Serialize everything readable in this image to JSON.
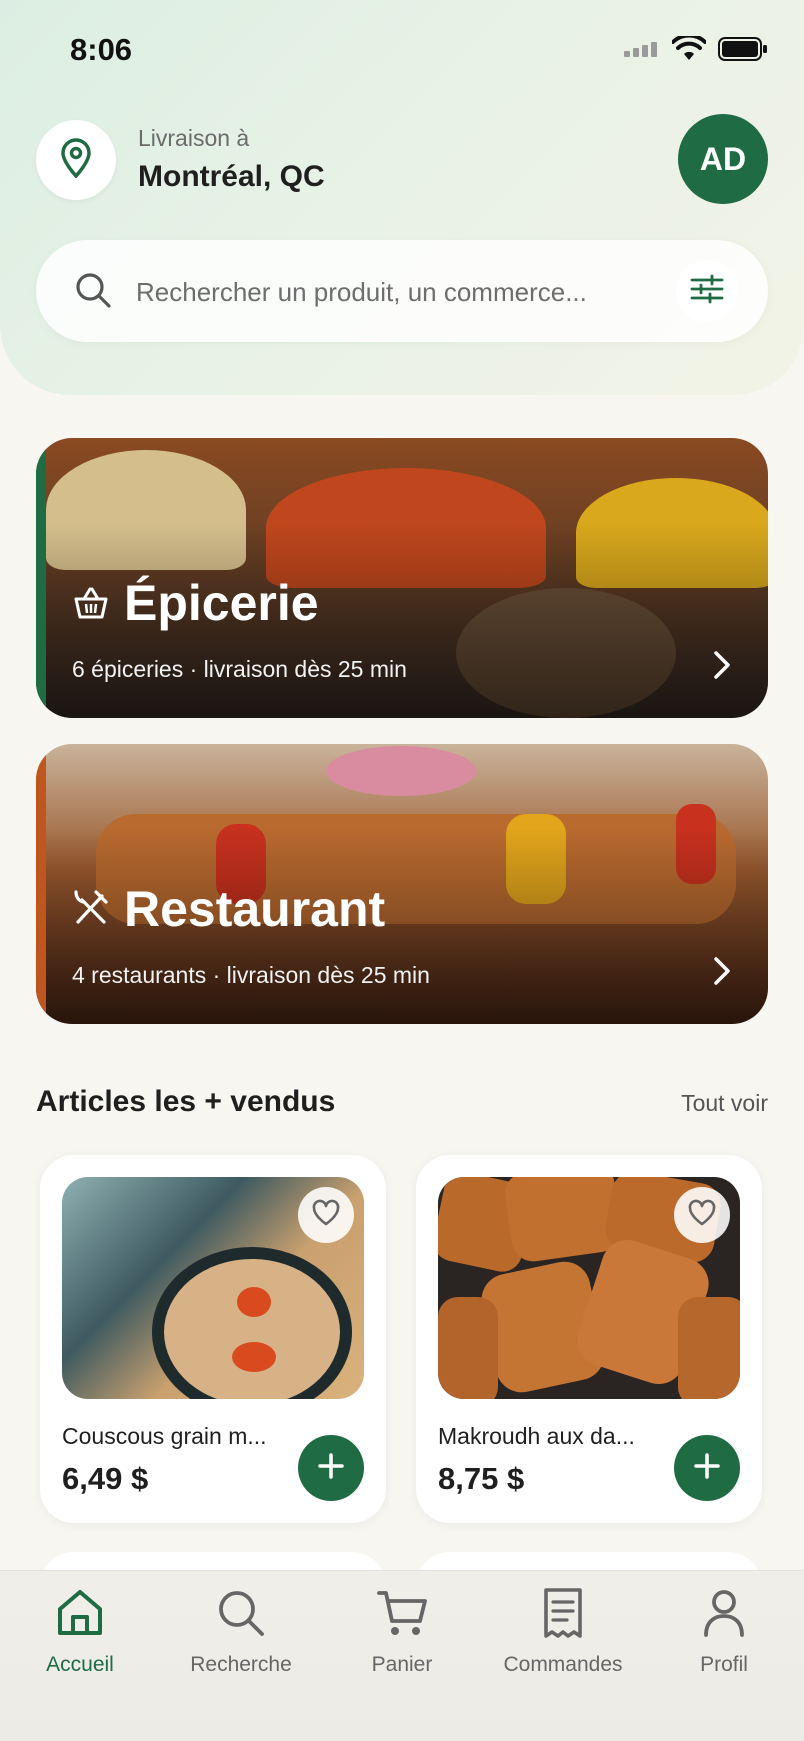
{
  "status": {
    "time": "8:06"
  },
  "header": {
    "delivery_label": "Livraison à",
    "delivery_city": "Montréal, QC",
    "avatar_initials": "AD"
  },
  "search": {
    "placeholder": "Rechercher un produit, un commerce..."
  },
  "categories": [
    {
      "title": "Épicerie",
      "subtitle": "6 épiceries · livraison dès 25 min",
      "accent": "#1f6b43",
      "icon": "basket-icon"
    },
    {
      "title": "Restaurant",
      "subtitle": "4 restaurants · livraison dès 25 min",
      "accent": "#c0561f",
      "icon": "utensils-icon"
    }
  ],
  "bestsellers": {
    "title": "Articles les + vendus",
    "see_all": "Tout voir",
    "items": [
      {
        "name": "Couscous grain m...",
        "price": "6,49 $"
      },
      {
        "name": "Makroudh aux da...",
        "price": "8,75 $"
      }
    ]
  },
  "tabs": [
    {
      "label": "Accueil",
      "icon": "home-icon",
      "active": true
    },
    {
      "label": "Recherche",
      "icon": "search-icon",
      "active": false
    },
    {
      "label": "Panier",
      "icon": "cart-icon",
      "active": false
    },
    {
      "label": "Commandes",
      "icon": "receipt-icon",
      "active": false
    },
    {
      "label": "Profil",
      "icon": "user-icon",
      "active": false
    }
  ],
  "colors": {
    "primary": "#1f6b43",
    "background": "#f7f6f1"
  }
}
